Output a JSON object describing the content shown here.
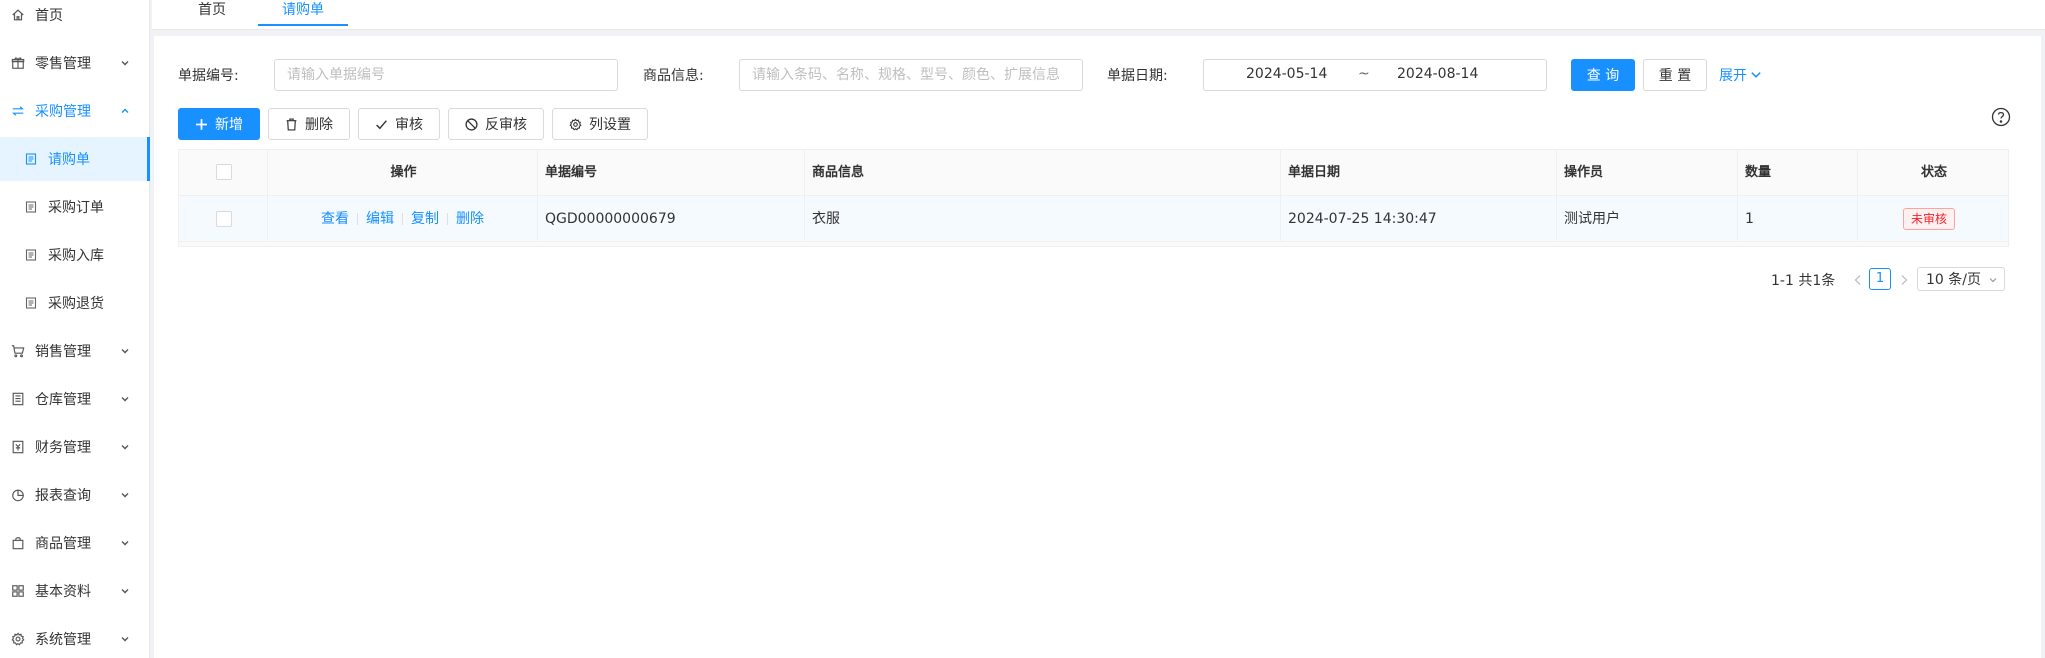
{
  "sidebar": {
    "items": [
      {
        "label": "首页",
        "icon": "home-icon"
      },
      {
        "label": "零售管理",
        "icon": "gift-icon"
      },
      {
        "label": "采购管理",
        "icon": "swap-icon",
        "open": true
      },
      {
        "label": "销售管理",
        "icon": "cart-icon"
      },
      {
        "label": "仓库管理",
        "icon": "warehouse-icon"
      },
      {
        "label": "财务管理",
        "icon": "finance-icon"
      },
      {
        "label": "报表查询",
        "icon": "pie-chart-icon"
      },
      {
        "label": "商品管理",
        "icon": "shopping-bag-icon"
      },
      {
        "label": "基本资料",
        "icon": "appstore-icon"
      },
      {
        "label": "系统管理",
        "icon": "setting-icon"
      }
    ],
    "subitems": [
      {
        "label": "请购单",
        "active": true
      },
      {
        "label": "采购订单"
      },
      {
        "label": "采购入库"
      },
      {
        "label": "采购退货"
      }
    ]
  },
  "tabs": [
    {
      "label": "首页"
    },
    {
      "label": "请购单",
      "active": true
    }
  ],
  "search": {
    "number_label": "单据编号:",
    "number_placeholder": "请输入单据编号",
    "goods_label": "商品信息:",
    "goods_placeholder": "请输入条码、名称、规格、型号、颜色、扩展信息",
    "date_label": "单据日期:",
    "date_start": "2024-05-14",
    "date_sep": "~",
    "date_end": "2024-08-14",
    "query_label": "查 询",
    "reset_label": "重 置",
    "expand_label": "展开"
  },
  "toolbar": {
    "add_label": "新增",
    "delete_label": "删除",
    "audit_label": "审核",
    "unaudit_label": "反审核",
    "columns_label": "列设置"
  },
  "table": {
    "columns": [
      "操作",
      "单据编号",
      "商品信息",
      "单据日期",
      "操作员",
      "数量",
      "状态"
    ],
    "rows": [
      {
        "actions": [
          "查看",
          "编辑",
          "复制",
          "删除"
        ],
        "number": "QGD00000000679",
        "goods": "衣服",
        "date": "2024-07-25 14:30:47",
        "operator": "测试用户",
        "quantity": "1",
        "status": "未审核"
      }
    ]
  },
  "pagination": {
    "summary": "1-1 共1条",
    "current": "1",
    "page_size": "10 条/页"
  },
  "colors": {
    "accent": "#1890ff",
    "status_unaudited": "#f5222d"
  }
}
